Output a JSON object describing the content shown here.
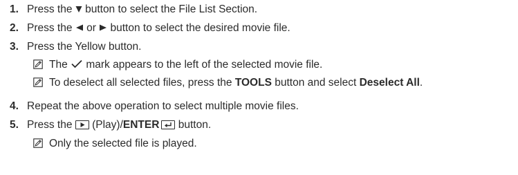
{
  "steps": [
    {
      "num": "1.",
      "pre": "Press the ",
      "icon": "down-triangle-icon",
      "post": " button to select the File List Section."
    },
    {
      "num": "2.",
      "pre": "Press the ",
      "icon_left": "left-triangle-icon",
      "mid": " or ",
      "icon_right": "right-triangle-icon",
      "post": " button to select the desired movie file."
    },
    {
      "num": "3.",
      "text": "Press the Yellow button.",
      "notes": [
        {
          "pre": "The ",
          "icon": "checkmark-icon",
          "post": " mark appears to the left of the selected movie file."
        },
        {
          "pre": "To deselect all selected files, press the ",
          "bold1": "TOOLS",
          "mid": " button and select ",
          "bold2": "Deselect All",
          "post": "."
        }
      ]
    },
    {
      "num": "4.",
      "text": "Repeat the above operation to select multiple movie files."
    },
    {
      "num": "5.",
      "pre": "Press the ",
      "play_icon": "play-button-icon",
      "mid": " (Play)/",
      "bold": "ENTER",
      "enter_icon": "enter-button-icon",
      "post": " button.",
      "notes": [
        {
          "text": "Only the selected file is played."
        }
      ]
    }
  ],
  "note_icon": "note-pencil-icon",
  "colors": {
    "text": "#2b2b2b",
    "background": "#ffffff"
  }
}
